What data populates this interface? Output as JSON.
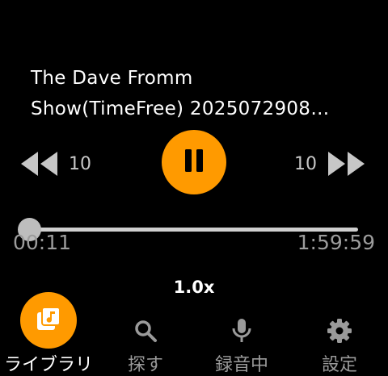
{
  "episode": {
    "title_line1": "The Dave Fromm",
    "title_line2": "Show(TimeFree) 2025072908…"
  },
  "controls": {
    "skip_back_label": "10",
    "skip_forward_label": "10",
    "state": "playing",
    "icons": {
      "skip_back": "rewind-icon",
      "skip_forward": "fast-forward-icon",
      "play_pause": "pause-icon"
    }
  },
  "progress": {
    "elapsed": "00:11",
    "total": "1:59:59",
    "fraction": 0.0015
  },
  "speed": {
    "label": "1.0x"
  },
  "nav": {
    "items": [
      {
        "label": "ライブラリ",
        "icon": "library-music-icon",
        "active": true
      },
      {
        "label": "探す",
        "icon": "search-icon",
        "active": false
      },
      {
        "label": "録音中",
        "icon": "microphone-icon",
        "active": false
      },
      {
        "label": "設定",
        "icon": "gear-icon",
        "active": false
      }
    ]
  },
  "colors": {
    "accent": "#ff9a00",
    "background": "#000000",
    "inactive": "#9a9a9a",
    "track": "#cfcfcf"
  }
}
